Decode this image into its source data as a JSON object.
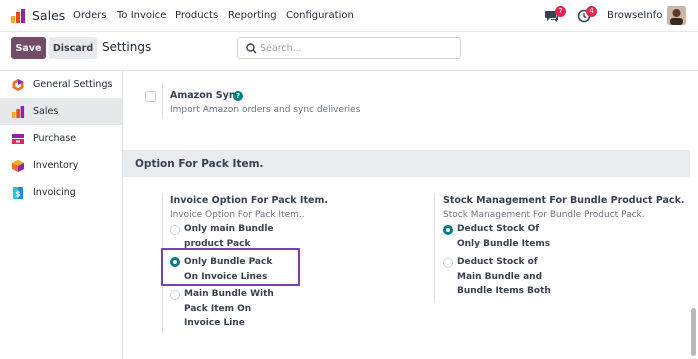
{
  "navbar": {
    "app_name": "Sales",
    "menu": [
      "Orders",
      "To Invoice",
      "Products",
      "Reporting",
      "Configuration"
    ],
    "messages_count": "7",
    "activities_count": "4",
    "company": "BrowseInfo",
    "brand_color": "#714b67",
    "badge_color": "#e0284e"
  },
  "control_panel": {
    "save_label": "Save",
    "discard_label": "Discard",
    "title": "Settings",
    "search_placeholder": "Search..."
  },
  "sidebar": {
    "items": [
      {
        "label": "General Settings",
        "icon": "odoo-settings-icon",
        "active": false
      },
      {
        "label": "Sales",
        "icon": "sales-app-icon",
        "active": true
      },
      {
        "label": "Purchase",
        "icon": "purchase-app-icon",
        "active": false
      },
      {
        "label": "Inventory",
        "icon": "inventory-app-icon",
        "active": false
      },
      {
        "label": "Invoicing",
        "icon": "invoicing-app-icon",
        "active": false
      }
    ]
  },
  "content": {
    "amazon_sync": {
      "title": "Amazon Sync",
      "description": "Import Amazon orders and sync deliveries",
      "checked": false
    },
    "section_title": "Option For Pack Item.",
    "invoice_option": {
      "title": "Invoice Option For Pack Item.",
      "description": "Invoice Option For Pack Item..",
      "options": [
        {
          "label": "Only main Bundle product Pack",
          "checked": false
        },
        {
          "label": "Only Bundle Pack On Invoice Lines",
          "checked": true
        },
        {
          "label": "Main Bundle With Pack Item On Invoice Line",
          "checked": false
        }
      ]
    },
    "stock_management": {
      "title": "Stock Management For Bundle Product Pack.",
      "description": "Stock Management For Bundle Product Pack.",
      "options": [
        {
          "label": "Deduct Stock Of Only Bundle Items",
          "checked": true
        },
        {
          "label": "Deduct Stock of Main Bundle and Bundle Items Both",
          "checked": false
        }
      ]
    },
    "accent_color": "#017e84",
    "highlight_color": "#7b3fb3"
  }
}
